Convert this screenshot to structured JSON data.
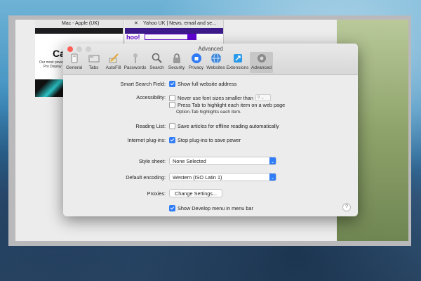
{
  "browser": {
    "tab1_title": "Mac - Apple (UK)",
    "tab2_title": "Yahoo UK | News, email and se...",
    "apple_heading": "Ca",
    "apple_line1": "Our most powerfu",
    "apple_line2": "Pro Display",
    "yahoo_logo": "hoo!"
  },
  "window": {
    "title": "Advanced",
    "toolbar": [
      {
        "label": "General",
        "icon": "general-icon"
      },
      {
        "label": "Tabs",
        "icon": "tabs-icon"
      },
      {
        "label": "AutoFill",
        "icon": "autofill-icon"
      },
      {
        "label": "Passwords",
        "icon": "passwords-icon"
      },
      {
        "label": "Search",
        "icon": "search-icon"
      },
      {
        "label": "Security",
        "icon": "security-icon"
      },
      {
        "label": "Privacy",
        "icon": "privacy-icon"
      },
      {
        "label": "Websites",
        "icon": "websites-icon"
      },
      {
        "label": "Extensions",
        "icon": "extensions-icon"
      },
      {
        "label": "Advanced",
        "icon": "advanced-gear-icon",
        "active": true
      }
    ]
  },
  "settings": {
    "smart_search": {
      "label": "Smart Search Field:",
      "option": "Show full website address",
      "checked": true
    },
    "accessibility": {
      "label": "Accessibility:",
      "font_option": "Never use font sizes smaller than",
      "font_size": "9",
      "tab_option": "Press Tab to highlight each item on a web page",
      "tab_hint": "Option-Tab highlights each item."
    },
    "reading_list": {
      "label": "Reading List:",
      "option": "Save articles for offline reading automatically"
    },
    "plugins": {
      "label": "Internet plug-ins:",
      "option": "Stop plug-ins to save power",
      "checked": true
    },
    "style_sheet": {
      "label": "Style sheet:",
      "value": "None Selected"
    },
    "encoding": {
      "label": "Default encoding:",
      "value": "Western (ISO Latin 1)"
    },
    "proxies": {
      "label": "Proxies:",
      "button": "Change Settings..."
    },
    "develop": {
      "option": "Show Develop menu in menu bar",
      "checked": true
    },
    "help": "?"
  },
  "colors": {
    "accent": "#2f7cf6",
    "close": "#fe5f57"
  }
}
